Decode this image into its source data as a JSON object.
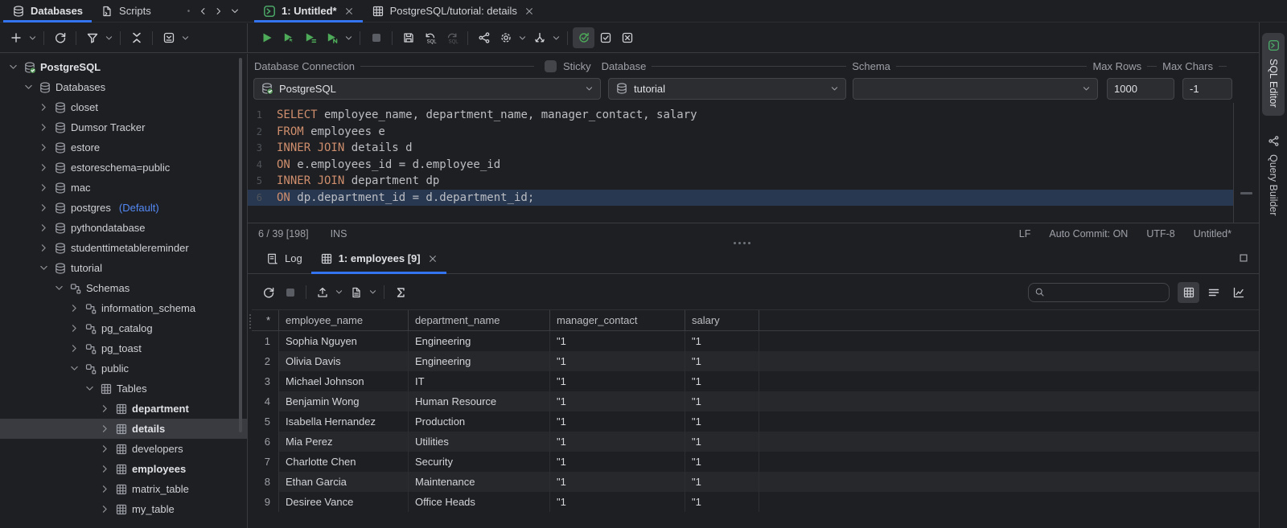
{
  "top_tabs": {
    "panel": [
      {
        "label": "Databases",
        "icon": "database",
        "active": true
      },
      {
        "label": "Scripts",
        "icon": "scripts",
        "active": false
      }
    ],
    "nav_icons": [
      "dot",
      "chevron-left",
      "chevron-right",
      "chevron-down"
    ],
    "editor": [
      {
        "label": "1: Untitled*",
        "icon": "console",
        "active": true,
        "closable": true
      },
      {
        "label": "PostgreSQL/tutorial: details",
        "icon": "table",
        "active": false,
        "closable": true
      }
    ]
  },
  "toolbars": {
    "panel": [
      {
        "icon": "add"
      },
      {
        "chev": true
      },
      {
        "sep": true
      },
      {
        "icon": "refresh"
      },
      {
        "sep": true
      },
      {
        "icon": "filter"
      },
      {
        "chev": true
      },
      {
        "sep": true
      },
      {
        "icon": "collapse-all"
      },
      {
        "sep": true
      },
      {
        "icon": "open-in-editor"
      },
      {
        "chev": true
      }
    ],
    "editor": [
      {
        "icon": "run",
        "green": true
      },
      {
        "icon": "run-cursor",
        "green": true
      },
      {
        "icon": "run-script",
        "green": true
      },
      {
        "icon": "run-n",
        "green": true
      },
      {
        "chev": true
      },
      {
        "sep": true
      },
      {
        "icon": "stop",
        "muted": true
      },
      {
        "sep": true
      },
      {
        "icon": "save"
      },
      {
        "icon": "undo-sql"
      },
      {
        "icon": "redo-sql",
        "muted": true
      },
      {
        "sep": true
      },
      {
        "icon": "share"
      },
      {
        "icon": "gear"
      },
      {
        "chev": true
      },
      {
        "icon": "merge"
      },
      {
        "chev": true
      },
      {
        "sep": true
      },
      {
        "icon": "autocommit",
        "green": true,
        "active": true
      },
      {
        "icon": "checkbox"
      },
      {
        "icon": "close-box"
      }
    ],
    "results": [
      {
        "icon": "refresh"
      },
      {
        "icon": "stop",
        "muted": true
      },
      {
        "sep": true
      },
      {
        "icon": "upload"
      },
      {
        "chev": true
      },
      {
        "icon": "doc"
      },
      {
        "chev": true
      },
      {
        "sep": true
      },
      {
        "icon": "sigma"
      }
    ],
    "view_toggles": [
      {
        "icon": "grid-view",
        "active": true
      },
      {
        "icon": "text-view"
      },
      {
        "icon": "chart-view"
      }
    ]
  },
  "tree": {
    "items": [
      {
        "label": "PostgreSQL",
        "level": 0,
        "state": "open",
        "icon": "db-check",
        "bold": true
      },
      {
        "label": "Databases",
        "level": 1,
        "state": "open",
        "icon": "db"
      },
      {
        "label": "closet",
        "level": 2,
        "state": "closed",
        "icon": "db"
      },
      {
        "label": "Dumsor Tracker",
        "level": 2,
        "state": "closed",
        "icon": "db"
      },
      {
        "label": "estore",
        "level": 2,
        "state": "closed",
        "icon": "db"
      },
      {
        "label": "estoreschema=public",
        "level": 2,
        "state": "closed",
        "icon": "db"
      },
      {
        "label": "mac",
        "level": 2,
        "state": "closed",
        "icon": "db"
      },
      {
        "label": "postgres",
        "level": 2,
        "state": "closed",
        "icon": "db",
        "badge": "(Default)"
      },
      {
        "label": "pythondatabase",
        "level": 2,
        "state": "closed",
        "icon": "db"
      },
      {
        "label": "studenttimetablereminder",
        "level": 2,
        "state": "closed",
        "icon": "db"
      },
      {
        "label": "tutorial",
        "level": 2,
        "state": "open",
        "icon": "db"
      },
      {
        "label": "Schemas",
        "level": 3,
        "state": "open",
        "icon": "schema"
      },
      {
        "label": "information_schema",
        "level": 4,
        "state": "closed",
        "icon": "schema"
      },
      {
        "label": "pg_catalog",
        "level": 4,
        "state": "closed",
        "icon": "schema"
      },
      {
        "label": "pg_toast",
        "level": 4,
        "state": "closed",
        "icon": "schema"
      },
      {
        "label": "public",
        "level": 4,
        "state": "open",
        "icon": "schema"
      },
      {
        "label": "Tables",
        "level": 5,
        "state": "open",
        "icon": "table"
      },
      {
        "label": "department",
        "level": 6,
        "state": "closed",
        "icon": "table",
        "bold": true
      },
      {
        "label": "details",
        "level": 6,
        "state": "closed",
        "icon": "table",
        "bold": true,
        "selected": true
      },
      {
        "label": "developers",
        "level": 6,
        "state": "closed",
        "icon": "table"
      },
      {
        "label": "employees",
        "level": 6,
        "state": "closed",
        "icon": "table",
        "bold": true
      },
      {
        "label": "matrix_table",
        "level": 6,
        "state": "closed",
        "icon": "table"
      },
      {
        "label": "my_table",
        "level": 6,
        "state": "closed",
        "icon": "table"
      }
    ]
  },
  "connection_bar": {
    "connection_label": "Database Connection",
    "sticky_label": "Sticky",
    "database_label": "Database",
    "schema_label": "Schema",
    "max_rows_label": "Max Rows",
    "max_chars_label": "Max Chars",
    "connection_value": "PostgreSQL",
    "database_value": "tutorial",
    "schema_value": "",
    "max_rows_value": "1000",
    "max_chars_value": "-1"
  },
  "sql": {
    "current_line": 6,
    "lines": [
      [
        {
          "kw": "SELECT"
        },
        {
          "t": " employee_name, department_name, manager_contact, salary"
        }
      ],
      [
        {
          "kw": "FROM"
        },
        {
          "t": " employees e"
        }
      ],
      [
        {
          "kw": "INNER JOIN"
        },
        {
          "t": " details d"
        }
      ],
      [
        {
          "kw": "ON"
        },
        {
          "t": " e.employees_id = d.employee_id"
        }
      ],
      [
        {
          "kw": "INNER JOIN"
        },
        {
          "t": " department dp"
        }
      ],
      [
        {
          "kw": "ON"
        },
        {
          "t": " dp.department_id = d.department_id;"
        }
      ]
    ]
  },
  "editor_status": {
    "position": "6 / 39 [198]",
    "mode": "INS",
    "line_ending": "LF",
    "auto_commit": "Auto Commit: ON",
    "encoding": "UTF-8",
    "file": "Untitled*"
  },
  "results": {
    "tabs": [
      {
        "label": "Log",
        "icon": "log",
        "active": false
      },
      {
        "label": "1: employees [9]",
        "icon": "table",
        "active": true,
        "closable": true
      }
    ],
    "search": {
      "value": "",
      "placeholder": ""
    },
    "table": {
      "columns": [
        "*",
        "employee_name",
        "department_name",
        "manager_contact",
        "salary"
      ],
      "rows": [
        [
          "1",
          "Sophia Nguyen",
          "Engineering",
          "\"1",
          "\"1"
        ],
        [
          "2",
          "Olivia Davis",
          "Engineering",
          "\"1",
          "\"1"
        ],
        [
          "3",
          "Michael Johnson",
          "IT",
          "\"1",
          "\"1"
        ],
        [
          "4",
          "Benjamin Wong",
          "Human Resource",
          "\"1",
          "\"1"
        ],
        [
          "5",
          "Isabella Hernandez",
          "Production",
          "\"1",
          "\"1"
        ],
        [
          "6",
          "Mia Perez",
          "Utilities",
          "\"1",
          "\"1"
        ],
        [
          "7",
          "Charlotte Chen",
          "Security",
          "\"1",
          "\"1"
        ],
        [
          "8",
          "Ethan Garcia",
          "Maintenance",
          "\"1",
          "\"1"
        ],
        [
          "9",
          "Desiree Vance",
          "Office Heads",
          "\"1",
          "\"1"
        ]
      ]
    }
  },
  "right_strip": {
    "tabs": [
      {
        "label": "SQL Editor",
        "icon": "console",
        "active": true
      },
      {
        "label": "Query Builder",
        "icon": "share",
        "active": false
      }
    ]
  },
  "colors": {
    "accent_blue": "#3574F0",
    "run_green": "#4DAA59",
    "console_green": "#4BA667",
    "keyword_orange": "#CF8E6D",
    "default_badge_blue": "#548AF7",
    "selection_gray": "#393B40",
    "caret_line": "#283850"
  }
}
